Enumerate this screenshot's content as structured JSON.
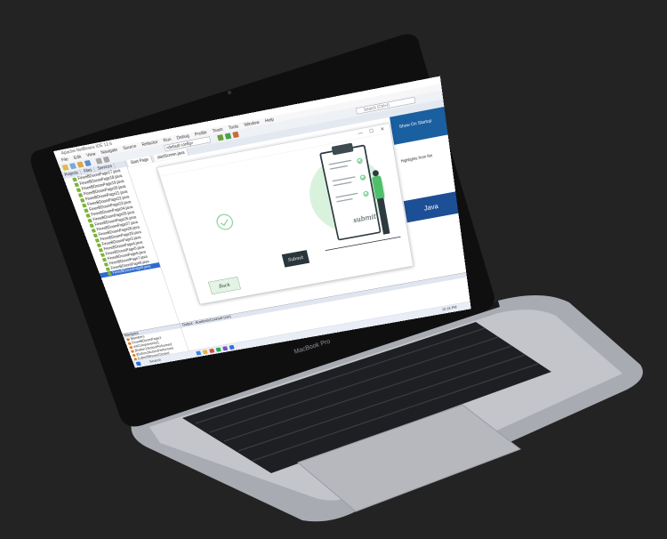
{
  "ide": {
    "title": "Apache NetBeans IDE 12.6",
    "menu": [
      "File",
      "Edit",
      "View",
      "Navigate",
      "Source",
      "Refactor",
      "Run",
      "Debug",
      "Profile",
      "Team",
      "Tools",
      "Window",
      "Help"
    ],
    "config": "<default config>",
    "search_placeholder": "Search (Ctrl+I)",
    "panel_tabs": [
      "Projects",
      "Files",
      "Services"
    ],
    "files": [
      "FineeBDoomPage17.java",
      "FineeBDoomPage18.java",
      "FineeBDoomPage19.java",
      "FineeBDoomPage20.java",
      "FineeBDoomPage21.java",
      "FineeBDoomPage22.java",
      "FineeBDoomPage23.java",
      "FineeBDoomPage24.java",
      "FineeBDoomPage25.java",
      "FineeBDoomPage26.java",
      "FineeBDoomPage27.java",
      "FineeBDoomPage28.java",
      "FineeBDoomPage29.java",
      "FineeBDoomPage3.java",
      "FineeBDoomPage4.java",
      "FineeBDoomPage5.java",
      "FineeBDoomPage6.java",
      "FineeBDoomPage7.java",
      "FineeBDoomPage8.java",
      "FineeBDoomPage9.java"
    ],
    "selected_file_index": 19,
    "editor_tabs": [
      "Start Page",
      "startScreen.java"
    ],
    "navigator_tab": "Navigator",
    "navigator_items": [
      "Members",
      "FineeBDoomPage3",
      "initComponents()",
      "jButton1ActionPerformed",
      "jButton2ActionPerformed",
      "jLabel3MouseClicked"
    ],
    "output_tab": "Output - AcademicCounsel (run)",
    "taskbar_search": "Search",
    "taskbar_time": "10:16 PM"
  },
  "side_window": {
    "header": "Show On Startup",
    "body": "Highlights from the",
    "brand": "Java"
  },
  "dialog": {
    "illustration_text": "submit",
    "submit_label": "Submit",
    "back_label": "Back",
    "minimize": "—",
    "maximize": "☐",
    "close": "✕"
  },
  "laptop": {
    "model": "MacBook Pro"
  }
}
